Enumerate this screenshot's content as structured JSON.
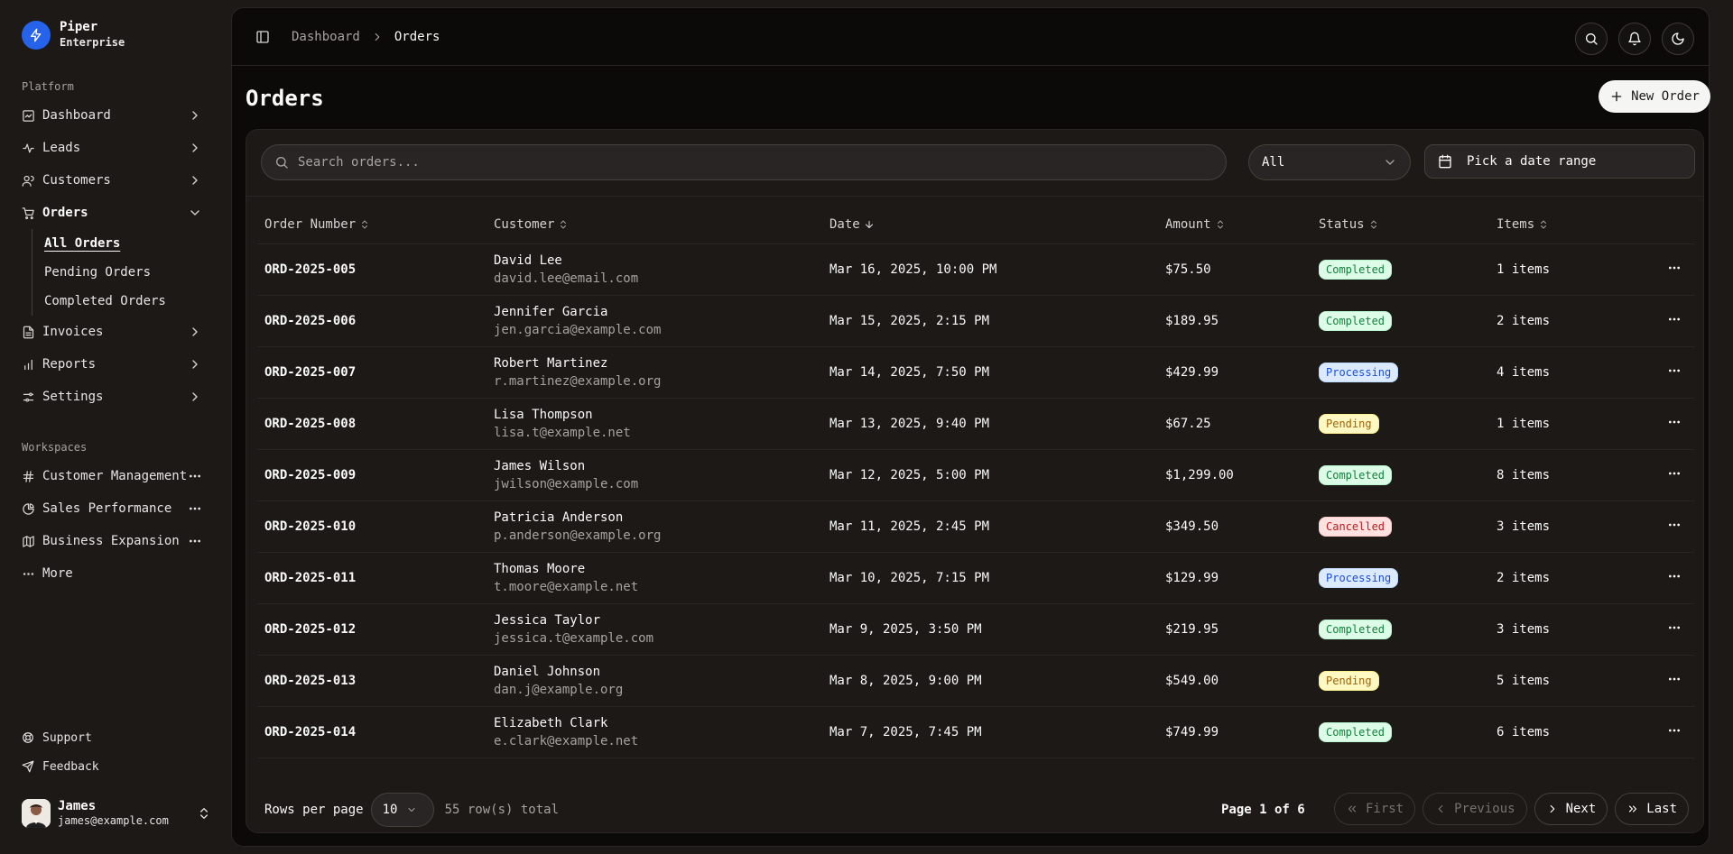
{
  "brand": {
    "name": "Piper",
    "plan": "Enterprise"
  },
  "sidebar": {
    "platform_label": "Platform",
    "items": [
      {
        "label": "Dashboard",
        "icon": "dashboard-icon"
      },
      {
        "label": "Leads",
        "icon": "leads-icon"
      },
      {
        "label": "Customers",
        "icon": "users-icon"
      },
      {
        "label": "Orders",
        "icon": "cart-icon",
        "expanded": true
      },
      {
        "label": "Invoices",
        "icon": "file-icon"
      },
      {
        "label": "Reports",
        "icon": "chart-icon"
      },
      {
        "label": "Settings",
        "icon": "settings-icon"
      }
    ],
    "orders_sub": [
      "All Orders",
      "Pending Orders",
      "Completed Orders"
    ],
    "workspaces_label": "Workspaces",
    "workspaces": [
      "Customer Management",
      "Sales Performance",
      "Business Expansion"
    ],
    "more_label": "More",
    "footer": [
      "Support",
      "Feedback"
    ],
    "user": {
      "name": "James",
      "email": "james@example.com"
    }
  },
  "header": {
    "breadcrumb": [
      "Dashboard",
      "Orders"
    ]
  },
  "page": {
    "title": "Orders",
    "new_button": "New Order"
  },
  "filters": {
    "search_placeholder": "Search orders...",
    "status_value": "All",
    "date_placeholder": "Pick a date range"
  },
  "table": {
    "columns": [
      "Order Number",
      "Customer",
      "Date",
      "Amount",
      "Status",
      "Items"
    ],
    "rows": [
      {
        "order": "ORD-2025-005",
        "name": "David Lee",
        "email": "david.lee@email.com",
        "date": "Mar 16, 2025, 10:00 PM",
        "amount": "$75.50",
        "status": "Completed",
        "items": "1 items"
      },
      {
        "order": "ORD-2025-006",
        "name": "Jennifer Garcia",
        "email": "jen.garcia@example.com",
        "date": "Mar 15, 2025, 2:15 PM",
        "amount": "$189.95",
        "status": "Completed",
        "items": "2 items"
      },
      {
        "order": "ORD-2025-007",
        "name": "Robert Martinez",
        "email": "r.martinez@example.org",
        "date": "Mar 14, 2025, 7:50 PM",
        "amount": "$429.99",
        "status": "Processing",
        "items": "4 items"
      },
      {
        "order": "ORD-2025-008",
        "name": "Lisa Thompson",
        "email": "lisa.t@example.net",
        "date": "Mar 13, 2025, 9:40 PM",
        "amount": "$67.25",
        "status": "Pending",
        "items": "1 items"
      },
      {
        "order": "ORD-2025-009",
        "name": "James Wilson",
        "email": "jwilson@example.com",
        "date": "Mar 12, 2025, 5:00 PM",
        "amount": "$1,299.00",
        "status": "Completed",
        "items": "8 items"
      },
      {
        "order": "ORD-2025-010",
        "name": "Patricia Anderson",
        "email": "p.anderson@example.org",
        "date": "Mar 11, 2025, 2:45 PM",
        "amount": "$349.50",
        "status": "Cancelled",
        "items": "3 items"
      },
      {
        "order": "ORD-2025-011",
        "name": "Thomas Moore",
        "email": "t.moore@example.net",
        "date": "Mar 10, 2025, 7:15 PM",
        "amount": "$129.99",
        "status": "Processing",
        "items": "2 items"
      },
      {
        "order": "ORD-2025-012",
        "name": "Jessica Taylor",
        "email": "jessica.t@example.com",
        "date": "Mar 9, 2025, 3:50 PM",
        "amount": "$219.95",
        "status": "Completed",
        "items": "3 items"
      },
      {
        "order": "ORD-2025-013",
        "name": "Daniel Johnson",
        "email": "dan.j@example.org",
        "date": "Mar 8, 2025, 9:00 PM",
        "amount": "$549.00",
        "status": "Pending",
        "items": "5 items"
      },
      {
        "order": "ORD-2025-014",
        "name": "Elizabeth Clark",
        "email": "e.clark@example.net",
        "date": "Mar 7, 2025, 7:45 PM",
        "amount": "$749.99",
        "status": "Completed",
        "items": "6 items"
      }
    ]
  },
  "pagination": {
    "rows_per_page_label": "Rows per page",
    "rows_per_page": "10",
    "total": "55 row(s) total",
    "page_info": "Page 1 of 6",
    "first": "First",
    "previous": "Previous",
    "next": "Next",
    "last": "Last"
  },
  "colors": {
    "accent": "#2563eb",
    "completed": "#15803d",
    "processing": "#1d4ed8",
    "pending": "#a16207",
    "cancelled": "#b91c1c"
  }
}
